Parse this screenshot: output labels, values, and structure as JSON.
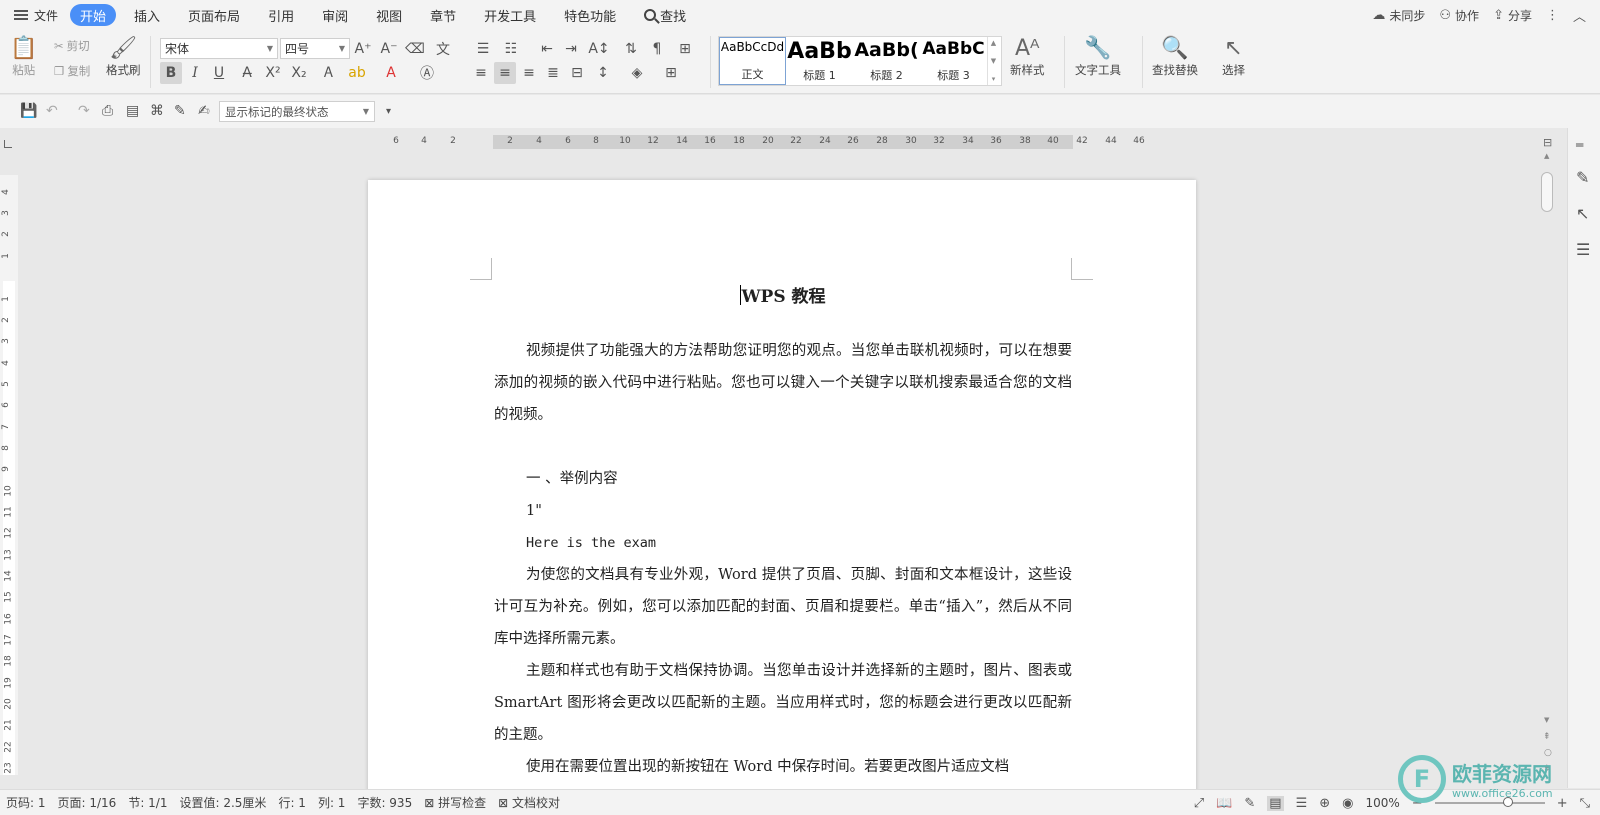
{
  "menubar": {
    "file_label": "文件",
    "tabs": [
      "开始",
      "插入",
      "页面布局",
      "引用",
      "审阅",
      "视图",
      "章节",
      "开发工具",
      "特色功能"
    ],
    "active_tab": "开始",
    "search_label": "查找",
    "right": {
      "sync_label": "未同步",
      "collab_label": "协作",
      "share_label": "分享"
    }
  },
  "ribbon": {
    "paste_label": "粘贴",
    "cut_label": "剪切",
    "copy_label": "复制",
    "format_painter_label": "格式刷",
    "font_name": "宋体",
    "font_size": "四号",
    "bold_glyph": "B",
    "italic_glyph": "I",
    "underline_glyph": "U",
    "styles": [
      {
        "preview": "AaBbCcDd",
        "label": "正文"
      },
      {
        "preview": "AaBb",
        "label": "标题 1"
      },
      {
        "preview": "AaBb(",
        "label": "标题 2"
      },
      {
        "preview": "AaBbC",
        "label": "标题 3"
      }
    ],
    "new_style_label": "新样式",
    "text_tools_label": "文字工具",
    "find_replace_label": "查找替换",
    "select_label": "选择"
  },
  "quickbar": {
    "markup_state": "显示标记的最终状态"
  },
  "ruler": {
    "h_ticks": [
      "6",
      "4",
      "2",
      "2",
      "4",
      "6",
      "8",
      "10",
      "12",
      "14",
      "16",
      "18",
      "20",
      "22",
      "24",
      "26",
      "28",
      "30",
      "32",
      "34",
      "36",
      "38",
      "40",
      "42",
      "44",
      "46"
    ],
    "v_ticks": [
      "4",
      "3",
      "2",
      "1",
      "1",
      "2",
      "3",
      "4",
      "5",
      "6",
      "7",
      "8",
      "9",
      "10",
      "11",
      "12",
      "13",
      "14",
      "15",
      "16",
      "17",
      "18",
      "19",
      "20",
      "21",
      "22",
      "23"
    ]
  },
  "document": {
    "title": "WPS 教程",
    "p1": "视频提供了功能强大的方法帮助您证明您的观点。当您单击联机视频时，可以在想要添加的视频的嵌入代码中进行粘贴。您也可以键入一个关键字以联机搜索最适合您的文档的视频。",
    "heading1": "一 、举例内容",
    "line1": "1\"",
    "line2": "Here is the exam",
    "p2": "为使您的文档具有专业外观，Word 提供了页眉、页脚、封面和文本框设计，这些设计可互为补充。例如，您可以添加匹配的封面、页眉和提要栏。单击“插入”，然后从不同库中选择所需元素。",
    "p3": "主题和样式也有助于文档保持协调。当您单击设计并选择新的主题时，图片、图表或 SmartArt 图形将会更改以匹配新的主题。当应用样式时，您的标题会进行更改以匹配新的主题。",
    "p4": "使用在需要位置出现的新按钮在 Word 中保存时间。若要更改图片适应文档"
  },
  "statusbar": {
    "page_code": "页码: 1",
    "page": "页面: 1/16",
    "section": "节: 1/1",
    "setting": "设置值: 2.5厘米",
    "row": "行: 1",
    "col": "列: 1",
    "word_count": "字数: 935",
    "spell_check": "拼写检查",
    "doc_proof": "文档校对",
    "zoom": "100%"
  },
  "watermark": {
    "cn": "欧菲资源网",
    "en": "www.office26.com"
  },
  "colors": {
    "accent": "#4a8ff7",
    "watermark": "#5bb5b0"
  }
}
